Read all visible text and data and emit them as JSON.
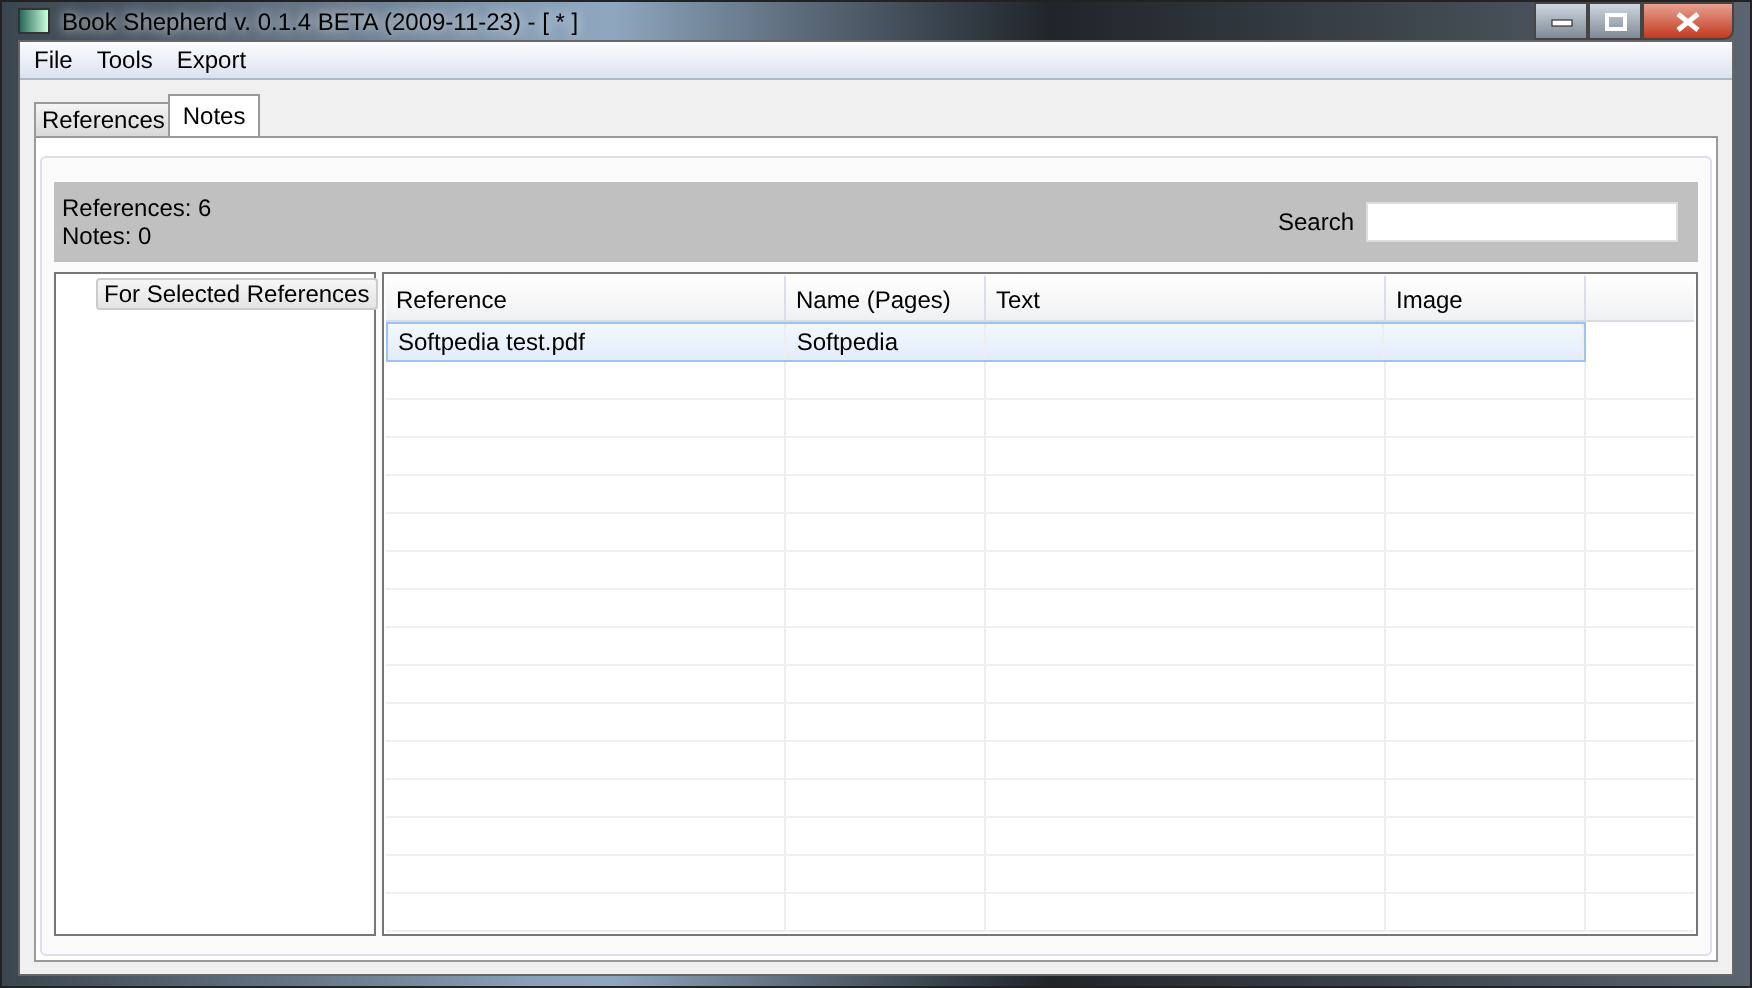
{
  "window": {
    "title": "Book Shepherd v. 0.1.4 BETA (2009-11-23) - [  * ]"
  },
  "menu": [
    "File",
    "Tools",
    "Export"
  ],
  "tabs": [
    {
      "label": "References",
      "selected": false
    },
    {
      "label": "Notes",
      "selected": true
    }
  ],
  "info": {
    "references": "References: 6",
    "notes": "Notes: 0"
  },
  "search": {
    "label": "Search"
  },
  "filter_button": "For Selected References",
  "table": {
    "columns": [
      "Reference",
      "Name (Pages)",
      "Text",
      "Image"
    ],
    "rows": [
      {
        "cells": [
          "Softpedia test.pdf",
          "Softpedia",
          "",
          ""
        ],
        "selected": true
      }
    ]
  }
}
